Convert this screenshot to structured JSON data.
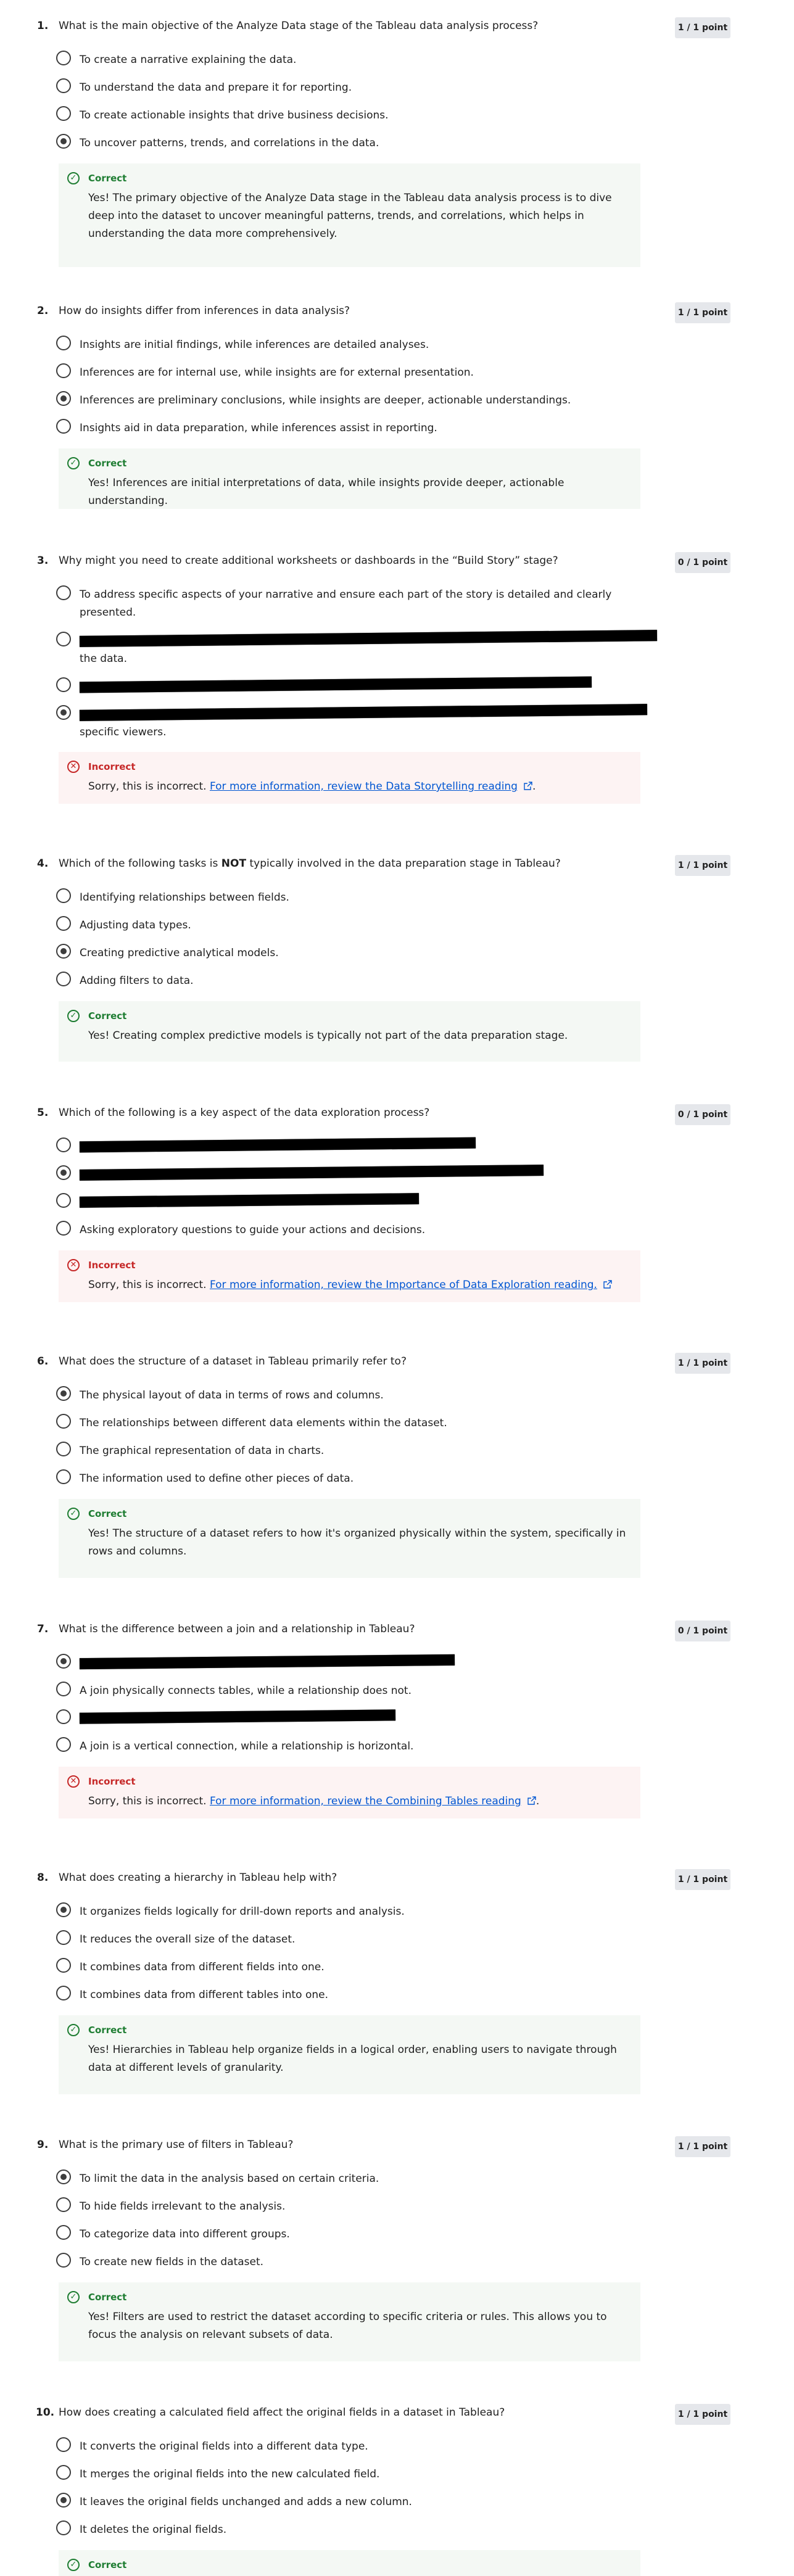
{
  "questions": [
    {
      "num": "1.",
      "text": "What is the main objective of the Analyze Data stage of the Tableau data analysis process?",
      "score": "1 / 1 point",
      "options": [
        "To create a narrative explaining the data.",
        "To understand the data and prepare it for reporting.",
        "To create actionable insights that drive business decisions.",
        "To uncover patterns, trends, and correlations in the data."
      ],
      "selected": 3,
      "feedback": {
        "status": "Correct",
        "text": "Yes! The primary objective of the Analyze Data stage in the Tableau data analysis process is to dive deep into the dataset to uncover meaningful patterns, trends, and correlations, which helps in understanding the data more comprehensively."
      }
    },
    {
      "num": "2.",
      "text": "How do insights differ from inferences in data analysis?",
      "score": "1 / 1 point",
      "options": [
        "Insights are initial findings, while inferences are detailed analyses.",
        "Inferences are for internal use, while insights are for external presentation.",
        "Inferences are preliminary conclusions, while insights are deeper, actionable understandings.",
        "Insights aid in data preparation, while inferences assist in reporting."
      ],
      "selected": 2,
      "feedback": {
        "status": "Correct",
        "text": "Yes! Inferences are initial interpretations of data, while insights provide deeper, actionable understanding."
      }
    },
    {
      "num": "3.",
      "text": "Why might you need to create additional worksheets or dashboards in the “Build Story” stage?",
      "score": "0 / 1 point",
      "options": [
        "To address specific aspects of your narrative and ensure each part of the story is detailed and clearly presented.",
        "the data.",
        "",
        "specific viewers."
      ],
      "selected": 3,
      "feedback": {
        "status": "Incorrect",
        "text": "Sorry, this is incorrect.",
        "link": "For more information, review the Data Storytelling reading"
      }
    },
    {
      "num": "4.",
      "text_pre": "Which of the following tasks is ",
      "text_bold": "NOT",
      "text_post": " typically involved in the data preparation stage in Tableau?",
      "score": "1 / 1 point",
      "options": [
        "Identifying relationships between fields.",
        "Adjusting data types.",
        "Creating predictive analytical models.",
        "Adding filters to data."
      ],
      "selected": 2,
      "feedback": {
        "status": "Correct",
        "text": "Yes! Creating complex predictive models is typically not part of the data preparation stage."
      }
    },
    {
      "num": "5.",
      "text": "Which of the following is a key aspect of the data exploration process?",
      "score": "0 / 1 point",
      "options": [
        "",
        "",
        "",
        "Asking exploratory questions to guide your actions and decisions."
      ],
      "selected": 1,
      "feedback": {
        "status": "Incorrect",
        "text": "Sorry, this is incorrect.",
        "link": "For more information, review the Importance of Data Exploration reading."
      }
    },
    {
      "num": "6.",
      "text": "What does the structure of a dataset in Tableau primarily refer to?",
      "score": "1 / 1 point",
      "options": [
        "The physical layout of data in terms of rows and columns.",
        "The relationships between different data elements within the dataset.",
        "The graphical representation of data in charts.",
        "The information used to define other pieces of data."
      ],
      "selected": 0,
      "feedback": {
        "status": "Correct",
        "text": "Yes! The structure of a dataset refers to how it's organized physically within the system, specifically in rows and columns."
      }
    },
    {
      "num": "7.",
      "text": "What is the difference between a join and a relationship in Tableau?",
      "score": "0 / 1 point",
      "options": [
        "",
        "A join physically connects tables, while a relationship does not.",
        "",
        "A join is a vertical connection, while a relationship is horizontal."
      ],
      "selected": 0,
      "feedback": {
        "status": "Incorrect",
        "text": "Sorry, this is incorrect.",
        "link": "For more information, review the Combining Tables reading"
      }
    },
    {
      "num": "8.",
      "text": "What does creating a hierarchy in Tableau help with?",
      "score": "1 / 1 point",
      "options": [
        "It organizes fields logically for drill-down reports and analysis.",
        "It reduces the overall size of the dataset.",
        "It combines data from different fields into one.",
        "It combines data from different tables into one."
      ],
      "selected": 0,
      "feedback": {
        "status": "Correct",
        "text": "Yes! Hierarchies in Tableau help organize fields in a logical order, enabling users to navigate through data at different levels of granularity."
      }
    },
    {
      "num": "9.",
      "text": "What is the primary use of filters in Tableau?",
      "score": "1 / 1 point",
      "options": [
        "To limit the data in the analysis based on certain criteria.",
        "To hide fields irrelevant to the analysis.",
        "To categorize data into different groups.",
        "To create new fields in the dataset."
      ],
      "selected": 0,
      "feedback": {
        "status": "Correct",
        "text": "Yes! Filters are used to restrict the dataset according to specific criteria or rules. This allows you to focus the analysis on relevant subsets of data."
      }
    },
    {
      "num": "10.",
      "text": "How does creating a calculated field affect the original fields in a dataset in Tableau?",
      "score": "1 / 1 point",
      "options": [
        "It converts the original fields into a different data type.",
        "It merges the original fields into the new calculated field.",
        "It leaves the original fields unchanged and adds a new column.",
        "It deletes the original fields."
      ],
      "selected": 2,
      "feedback": {
        "status": "Correct"
      }
    }
  ],
  "colors": {
    "correct": "#1e7d32",
    "incorrect": "#c62828",
    "link": "#0056d2",
    "score_bg": "#e5e7eb"
  },
  "icons": [
    "radio-button-icon",
    "check-circle-icon",
    "x-circle-icon",
    "external-link-icon"
  ]
}
